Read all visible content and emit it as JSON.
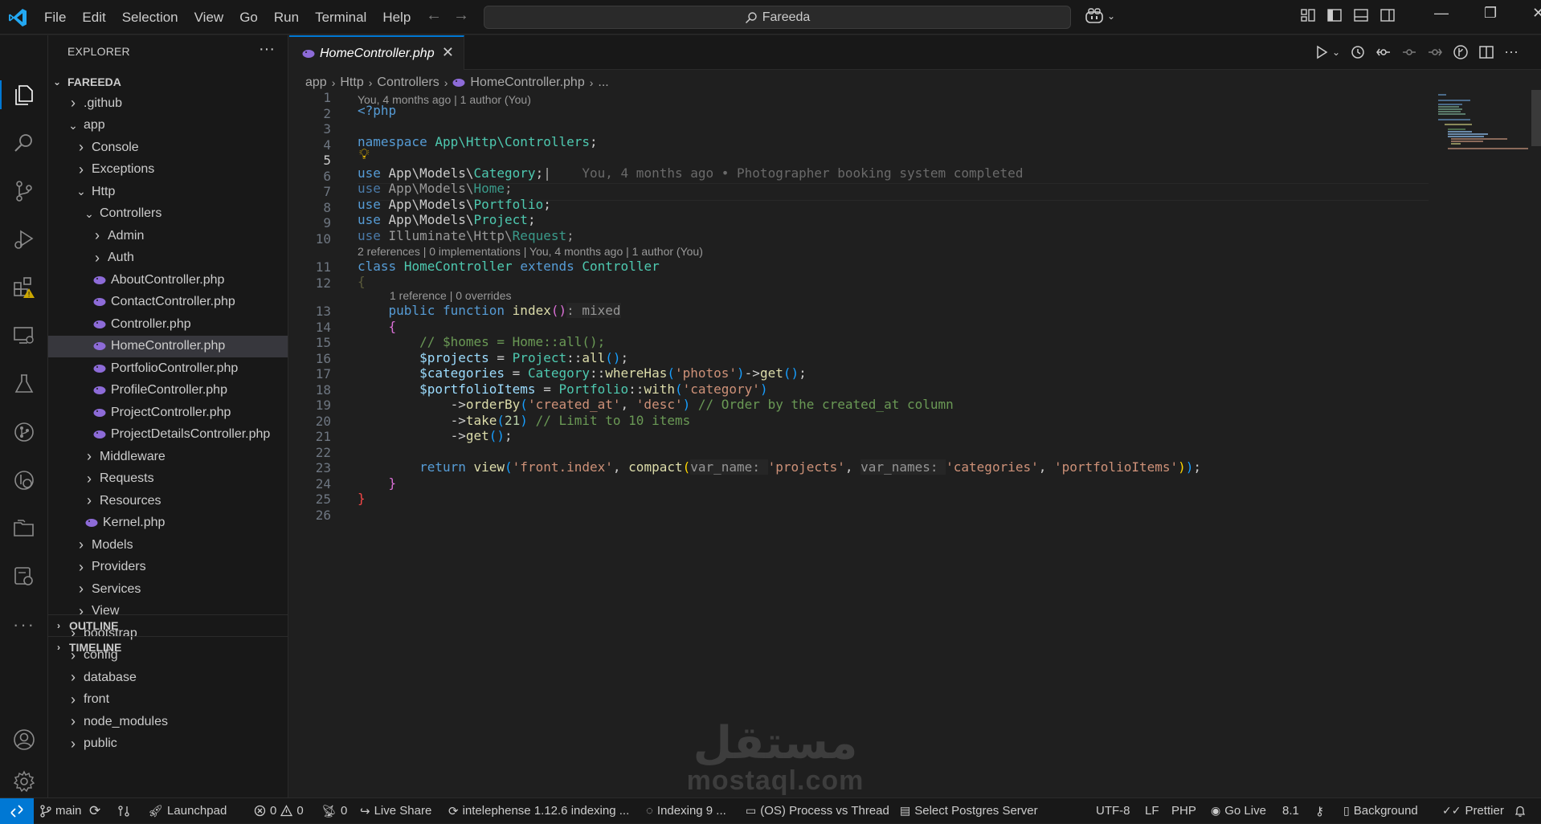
{
  "window": {
    "title": "Fareeda"
  },
  "menu": [
    "File",
    "Edit",
    "Selection",
    "View",
    "Go",
    "Run",
    "Terminal",
    "Help"
  ],
  "explorer": {
    "title": "EXPLORER",
    "root": "FAREEDA",
    "items": [
      {
        "label": ".github",
        "depth": 1,
        "kind": "folder",
        "open": false
      },
      {
        "label": "app",
        "depth": 1,
        "kind": "folder",
        "open": true
      },
      {
        "label": "Console",
        "depth": 2,
        "kind": "folder",
        "open": false
      },
      {
        "label": "Exceptions",
        "depth": 2,
        "kind": "folder",
        "open": false
      },
      {
        "label": "Http",
        "depth": 2,
        "kind": "folder",
        "open": true
      },
      {
        "label": "Controllers",
        "depth": 3,
        "kind": "folder",
        "open": true
      },
      {
        "label": "Admin",
        "depth": 4,
        "kind": "folder",
        "open": false
      },
      {
        "label": "Auth",
        "depth": 4,
        "kind": "folder",
        "open": false
      },
      {
        "label": "AboutController.php",
        "depth": 4,
        "kind": "php"
      },
      {
        "label": "ContactController.php",
        "depth": 4,
        "kind": "php"
      },
      {
        "label": "Controller.php",
        "depth": 4,
        "kind": "php"
      },
      {
        "label": "HomeController.php",
        "depth": 4,
        "kind": "php",
        "selected": true
      },
      {
        "label": "PortfolioController.php",
        "depth": 4,
        "kind": "php"
      },
      {
        "label": "ProfileController.php",
        "depth": 4,
        "kind": "php"
      },
      {
        "label": "ProjectController.php",
        "depth": 4,
        "kind": "php"
      },
      {
        "label": "ProjectDetailsController.php",
        "depth": 4,
        "kind": "php"
      },
      {
        "label": "Middleware",
        "depth": 3,
        "kind": "folder",
        "open": false
      },
      {
        "label": "Requests",
        "depth": 3,
        "kind": "folder",
        "open": false
      },
      {
        "label": "Resources",
        "depth": 3,
        "kind": "folder",
        "open": false
      },
      {
        "label": "Kernel.php",
        "depth": 3,
        "kind": "php"
      },
      {
        "label": "Models",
        "depth": 2,
        "kind": "folder",
        "open": false
      },
      {
        "label": "Providers",
        "depth": 2,
        "kind": "folder",
        "open": false
      },
      {
        "label": "Services",
        "depth": 2,
        "kind": "folder",
        "open": false
      },
      {
        "label": "View",
        "depth": 2,
        "kind": "folder",
        "open": false
      },
      {
        "label": "bootstrap",
        "depth": 1,
        "kind": "folder",
        "open": false
      },
      {
        "label": "config",
        "depth": 1,
        "kind": "folder",
        "open": false
      },
      {
        "label": "database",
        "depth": 1,
        "kind": "folder",
        "open": false
      },
      {
        "label": "front",
        "depth": 1,
        "kind": "folder",
        "open": false
      },
      {
        "label": "node_modules",
        "depth": 1,
        "kind": "folder",
        "open": false
      },
      {
        "label": "public",
        "depth": 1,
        "kind": "folder",
        "open": false
      }
    ],
    "outline": "OUTLINE",
    "timeline": "TIMELINE"
  },
  "tab": {
    "label": "HomeController.php",
    "close": "✕"
  },
  "breadcrumb": [
    "app",
    "Http",
    "Controllers",
    "HomeController.php",
    "..."
  ],
  "editor": {
    "lens_top": "You, 4 months ago | 1 author (You)",
    "lens_class": "2 references | 0 implementations | You, 4 months ago | 1 author (You)",
    "lens_method": "1 reference | 0 overrides",
    "blame": "You, 4 months ago • Photographer booking system completed",
    "line_numbers": [
      "1",
      "2",
      "3",
      "4",
      "5",
      "6",
      "7",
      "8",
      "9",
      "10",
      "11",
      "12",
      "13",
      "14",
      "15",
      "16",
      "17",
      "18",
      "19",
      "20",
      "21",
      "22",
      "23",
      "24",
      "25",
      "26"
    ]
  },
  "watermark": {
    "arabic": "مستقل",
    "latin": "mostaql.com"
  },
  "status": {
    "branch": "main",
    "launchpad": "Launchpad",
    "errors": "0",
    "warnings": "0",
    "ports": "0",
    "live_share": "Live Share",
    "intelephense": "intelephense 1.12.6 indexing ...",
    "indexing": "Indexing 9 ...",
    "os_process": "(OS) Process vs Thread",
    "postgres": "Select Postgres Server",
    "encoding": "UTF-8",
    "eol": "LF",
    "language": "PHP",
    "go_live": "Go Live",
    "version": "8.1",
    "background": "Background",
    "prettier": "Prettier"
  },
  "colors": {
    "accent": "#0078d4",
    "bg": "#1f1f1f",
    "sidebar": "#181818"
  }
}
